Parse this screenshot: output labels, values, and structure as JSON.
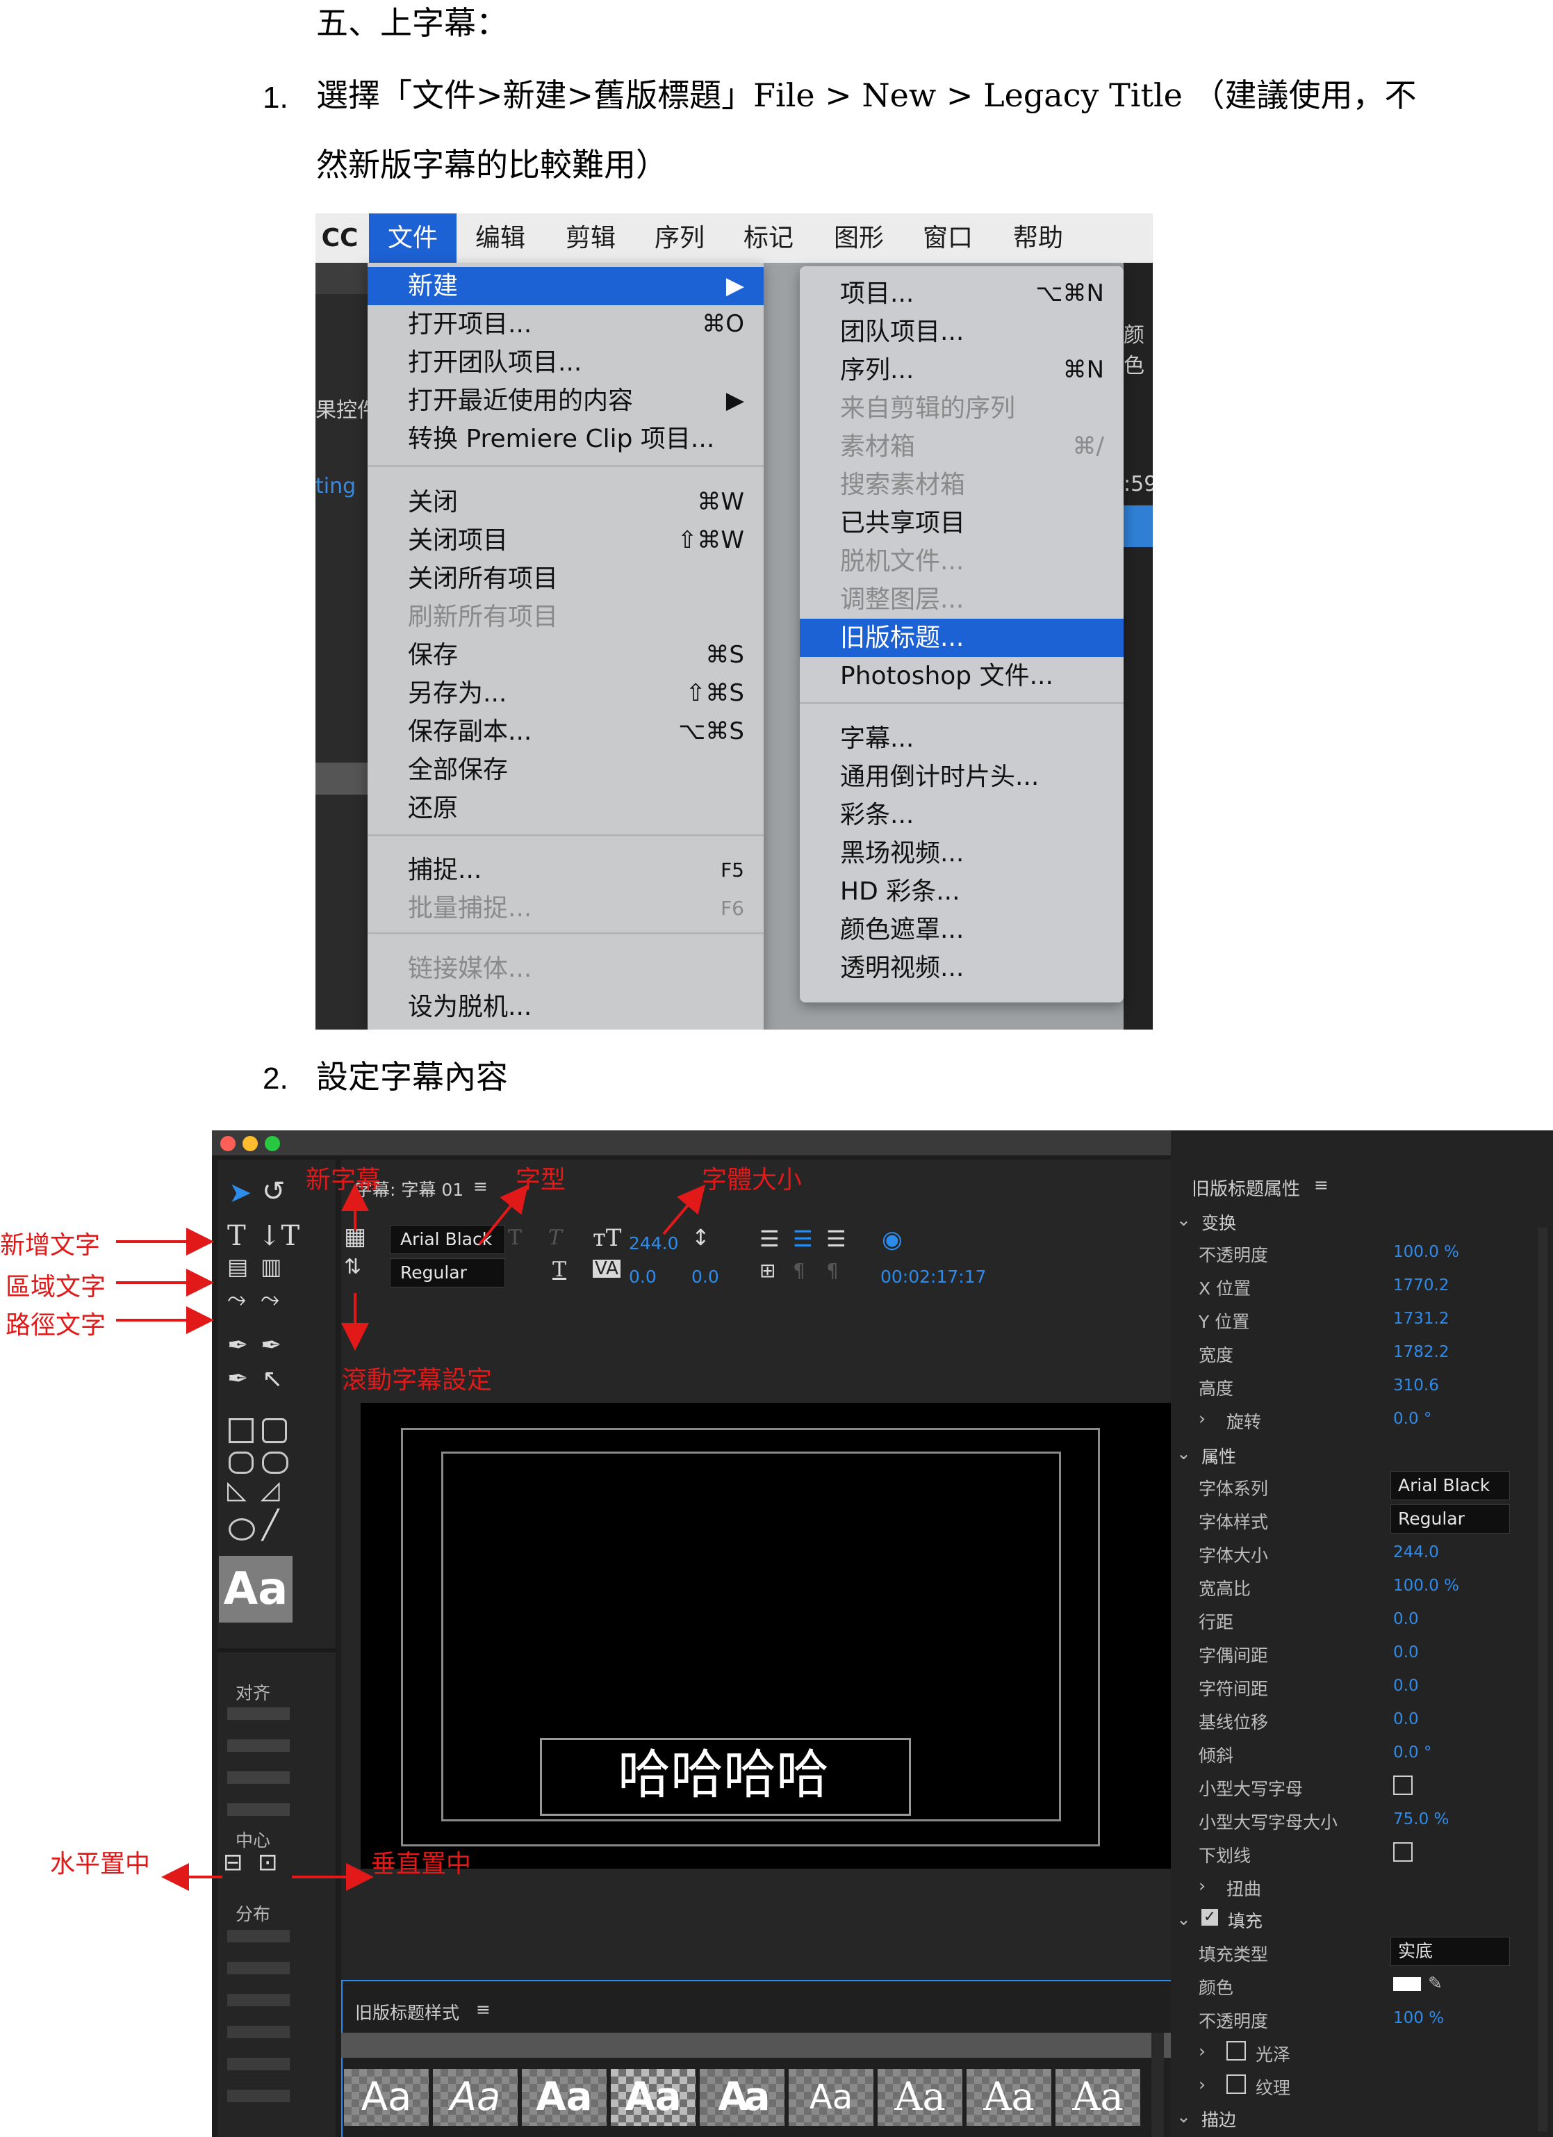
{
  "doc": {
    "heading": "五、上字幕：",
    "step1_num": "1.",
    "step1_line1": "選擇「文件>新建>舊版標題」File > New > Legacy Title （建議使用，不",
    "step1_line2": "然新版字幕的比較難用）",
    "step2_num": "2.",
    "step2_text": "設定字幕內容"
  },
  "menu_shot": {
    "menubar": [
      "CC",
      "文件",
      "编辑",
      "剪辑",
      "序列",
      "标记",
      "图形",
      "窗口",
      "帮助"
    ],
    "bg_fragments": [
      "果控件",
      "ting",
      ":59",
      "颜色"
    ],
    "file_menu": [
      {
        "label": "新建",
        "shortcut": "▶",
        "state": "highlight"
      },
      {
        "label": "打开项目...",
        "shortcut": "⌘O"
      },
      {
        "label": "打开团队项目...",
        "shortcut": ""
      },
      {
        "label": "打开最近使用的内容",
        "shortcut": "▶"
      },
      {
        "label": "转换 Premiere Clip 项目...",
        "shortcut": ""
      },
      {
        "label": "关闭",
        "shortcut": "⌘W"
      },
      {
        "label": "关闭项目",
        "shortcut": "⇧⌘W"
      },
      {
        "label": "关闭所有项目",
        "shortcut": ""
      },
      {
        "label": "刷新所有项目",
        "shortcut": "",
        "state": "disabled"
      },
      {
        "label": "保存",
        "shortcut": "⌘S"
      },
      {
        "label": "另存为...",
        "shortcut": "⇧⌘S"
      },
      {
        "label": "保存副本...",
        "shortcut": "⌥⌘S"
      },
      {
        "label": "全部保存",
        "shortcut": ""
      },
      {
        "label": "还原",
        "shortcut": ""
      },
      {
        "label": "捕捉...",
        "shortcut": "F5"
      },
      {
        "label": "批量捕捉...",
        "shortcut": "F6",
        "state": "disabled"
      },
      {
        "label": "链接媒体...",
        "shortcut": "",
        "state": "disabled"
      },
      {
        "label": "设为脱机...",
        "shortcut": ""
      }
    ],
    "new_submenu": [
      {
        "label": "项目...",
        "shortcut": "⌥⌘N"
      },
      {
        "label": "团队项目...",
        "shortcut": ""
      },
      {
        "label": "序列...",
        "shortcut": "⌘N"
      },
      {
        "label": "来自剪辑的序列",
        "shortcut": "",
        "state": "disabled"
      },
      {
        "label": "素材箱",
        "shortcut": "⌘/",
        "state": "disabled"
      },
      {
        "label": "搜索素材箱",
        "shortcut": "",
        "state": "disabled"
      },
      {
        "label": "已共享项目",
        "shortcut": ""
      },
      {
        "label": "脱机文件...",
        "shortcut": "",
        "state": "disabled"
      },
      {
        "label": "调整图层...",
        "shortcut": "",
        "state": "disabled"
      },
      {
        "label": "旧版标题...",
        "shortcut": "",
        "state": "highlight"
      },
      {
        "label": "Photoshop 文件...",
        "shortcut": ""
      },
      {
        "label": "字幕...",
        "shortcut": ""
      },
      {
        "label": "通用倒计时片头...",
        "shortcut": ""
      },
      {
        "label": "彩条...",
        "shortcut": ""
      },
      {
        "label": "黑场视频...",
        "shortcut": ""
      },
      {
        "label": "HD 彩条...",
        "shortcut": ""
      },
      {
        "label": "颜色遮罩...",
        "shortcut": ""
      },
      {
        "label": "透明视频...",
        "shortcut": ""
      }
    ]
  },
  "title_shot": {
    "tab_title": "字幕: 字幕 01",
    "font_family": "Arial Black",
    "font_style": "Regular",
    "font_size": "244.0",
    "kerning": "0.0",
    "tracking": "0.0",
    "timecode": "00:02:17:17",
    "canvas_text": "哈哈哈哈",
    "left_sections": {
      "align": "对齐",
      "center": "中心",
      "distribute": "分布"
    },
    "style_swatch": "Aa",
    "styles_panel_title": "旧版标题样式",
    "styles": [
      "Aa",
      "Aa",
      "Aa",
      "Aa",
      "Aa",
      "Aa",
      "Aa",
      "Aa",
      "Aa"
    ],
    "annotations": {
      "new_caption": "新字幕",
      "font": "字型",
      "font_size": "字體大小",
      "add_text": "新增文字",
      "area_text": "區域文字",
      "path_text": "路徑文字",
      "roll_settings": "滾動字幕設定",
      "h_center": "水平置中",
      "v_center": "垂直置中"
    },
    "properties": {
      "panel_title": "旧版标题属性",
      "transform_header": "变换",
      "opacity_label": "不透明度",
      "opacity": "100.0 %",
      "x_label": "X 位置",
      "x": "1770.2",
      "y_label": "Y 位置",
      "y": "1731.2",
      "width_label": "宽度",
      "width": "1782.2",
      "height_label": "高度",
      "height": "310.6",
      "rotation_label": "旋转",
      "rotation": "0.0 °",
      "attributes_header": "属性",
      "font_family_label": "字体系列",
      "font_family": "Arial Black",
      "font_style_label": "字体样式",
      "font_style": "Regular",
      "font_size_label": "字体大小",
      "font_size": "244.0",
      "aspect_label": "宽高比",
      "aspect": "100.0 %",
      "leading_label": "行距",
      "leading": "0.0",
      "kerning_label": "字偶间距",
      "kerning": "0.0",
      "tracking_label": "字符间距",
      "tracking": "0.0",
      "baseline_label": "基线位移",
      "baseline": "0.0",
      "slant_label": "倾斜",
      "slant": "0.0 °",
      "smallcaps_label": "小型大写字母",
      "smallcaps_size_label": "小型大写字母大小",
      "smallcaps_size": "75.0 %",
      "underline_label": "下划线",
      "distort_label": "扭曲",
      "fill_header": "填充",
      "fill_type_label": "填充类型",
      "fill_type": "实底",
      "color_label": "颜色",
      "fill_opacity_label": "不透明度",
      "fill_opacity": "100 %",
      "sheen_label": "光泽",
      "texture_label": "纹理",
      "stroke_header": "描边"
    }
  }
}
